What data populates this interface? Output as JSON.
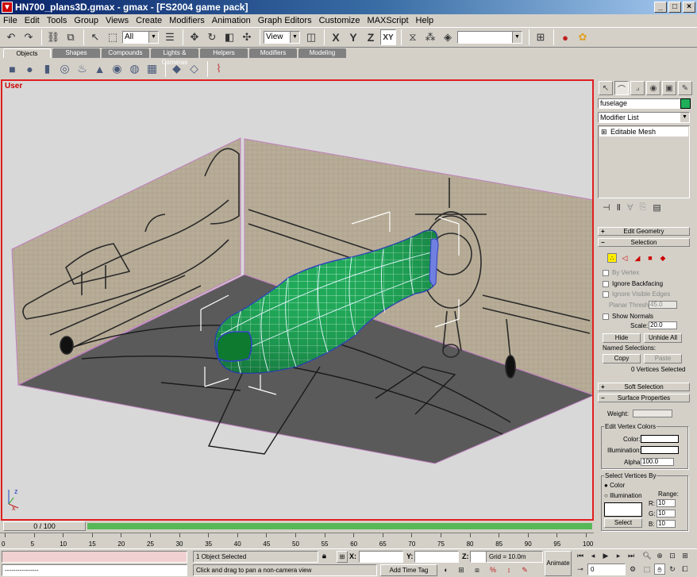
{
  "window": {
    "title": "HN700_plans3D.gmax - gmax - [FS2004 game pack]",
    "min": "_",
    "max": "□",
    "close": "×"
  },
  "menu": [
    "File",
    "Edit",
    "Tools",
    "Group",
    "Views",
    "Create",
    "Modifiers",
    "Animation",
    "Graph Editors",
    "Customize",
    "MAXScript",
    "Help"
  ],
  "toolbar": {
    "selection_filter": "All",
    "ref_coord": "View",
    "axis_x": "X",
    "axis_y": "Y",
    "axis_z": "Z",
    "axis_xy": "XY",
    "named_selection": ""
  },
  "tabs": [
    "Objects",
    "Shapes",
    "Compounds",
    "Lights & Cameras",
    "Helpers",
    "Modifiers",
    "Modeling"
  ],
  "viewport": {
    "label": "User",
    "axis_x": "x",
    "axis_z": "z",
    "colors": {
      "active_border": "#e02020",
      "mesh": "#1faf5a",
      "background": "#d8d8d8"
    }
  },
  "command_panel": {
    "object_name": "fuselage",
    "object_color": "#1faf5a",
    "modifier_list": "Modifier List",
    "stack_item": "Editable Mesh",
    "rollouts": {
      "edit_geometry": "Edit Geometry",
      "selection": "Selection",
      "soft_selection": "Soft Selection",
      "surface_properties": "Surface Properties"
    },
    "selection": {
      "by_vertex": "By Vertex",
      "ignore_backfacing": "Ignore Backfacing",
      "ignore_visible_edges": "Ignore Visible Edges",
      "planar_thresh_label": "Planar Thresh:",
      "planar_thresh": "45.0",
      "show_normals": "Show Normals",
      "scale_label": "Scale:",
      "scale": "20.0",
      "hide": "Hide",
      "unhide_all": "Unhide All",
      "named_selections": "Named Selections:",
      "copy": "Copy",
      "paste": "Paste",
      "status": "0 Vertices Selected"
    },
    "surface": {
      "weight_label": "Weight:",
      "weight": "",
      "edit_vertex_colors": "Edit Vertex Colors",
      "color_label": "Color:",
      "illumination_label": "Illumination:",
      "alpha_label": "Alpha:",
      "alpha": "100.0",
      "select_vertices_by": "Select Vertices By",
      "radio_color": "Color",
      "radio_illumination": "Illumination",
      "range_label": "Range:",
      "r_label": "R:",
      "g_label": "G:",
      "b_label": "B:",
      "r": "10",
      "g": "10",
      "b": "10",
      "select": "Select"
    }
  },
  "timeline": {
    "frame": "0 / 100",
    "ticks": [
      "0",
      "5",
      "10",
      "15",
      "20",
      "25",
      "30",
      "35",
      "40",
      "45",
      "50",
      "55",
      "60",
      "65",
      "70",
      "75",
      "80",
      "85",
      "90",
      "95",
      "100"
    ]
  },
  "status": {
    "script_line": "----------------",
    "selected": "1 Object Selected",
    "prompt": "Click and drag to pan a non-camera view",
    "x_label": "X:",
    "y_label": "Y:",
    "z_label": "Z:",
    "x": "",
    "y": "",
    "z": "",
    "grid": "Grid = 10.0m",
    "add_time_tag": "Add Time Tag",
    "animate": "Animate",
    "current_frame": "0"
  }
}
